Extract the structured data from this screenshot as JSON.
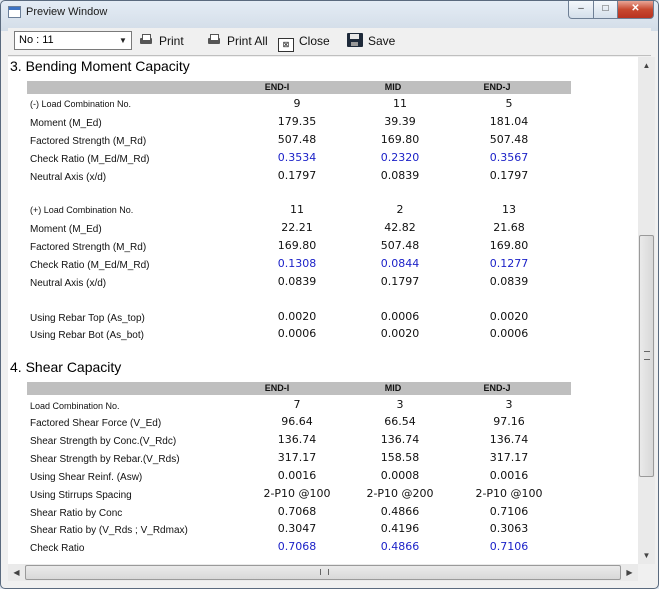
{
  "window": {
    "title": "Preview Window",
    "controls": {
      "minimize": "–",
      "maximize": "□",
      "close": "✕"
    }
  },
  "toolbar": {
    "select_value": "No : 11",
    "buttons": [
      {
        "label": "Print",
        "icon": "printer-icon"
      },
      {
        "label": "Print All",
        "icon": "printer-icon"
      },
      {
        "label": "Close",
        "icon": "close-window-icon"
      },
      {
        "label": "Save",
        "icon": "floppy-disk-icon"
      }
    ]
  },
  "columns": [
    "END-I",
    "MID",
    "END-J"
  ],
  "bending": {
    "title": "3. Bending Moment Capacity",
    "neg_rows": [
      {
        "label": "(-) Load Combination No.",
        "values": [
          "9",
          "11",
          "5"
        ]
      },
      {
        "label": "Moment (M_Ed)",
        "values": [
          "179.35",
          "39.39",
          "181.04"
        ]
      },
      {
        "label": "Factored Strength (M_Rd)",
        "values": [
          "507.48",
          "169.80",
          "507.48"
        ]
      },
      {
        "label": "Check Ratio (M_Ed/M_Rd)",
        "values": [
          "0.3534",
          "0.2320",
          "0.3567"
        ]
      },
      {
        "label": "Neutral Axis (x/d)",
        "values": [
          "0.1797",
          "0.0839",
          "0.1797"
        ]
      }
    ],
    "pos_rows": [
      {
        "label": "(+) Load Combination No.",
        "values": [
          "11",
          "2",
          "13"
        ]
      },
      {
        "label": "Moment (M_Ed)",
        "values": [
          "22.21",
          "42.82",
          "21.68"
        ]
      },
      {
        "label": "Factored Strength (M_Rd)",
        "values": [
          "169.80",
          "507.48",
          "169.80"
        ]
      },
      {
        "label": "Check Ratio (M_Ed/M_Rd)",
        "values": [
          "0.1308",
          "0.0844",
          "0.1277"
        ]
      },
      {
        "label": "Neutral Axis (x/d)",
        "values": [
          "0.0839",
          "0.1797",
          "0.0839"
        ]
      }
    ],
    "rebar_rows": [
      {
        "label": "Using Rebar Top (As_top)",
        "values": [
          "0.0020",
          "0.0006",
          "0.0020"
        ]
      },
      {
        "label": "Using Rebar Bot (As_bot)",
        "values": [
          "0.0006",
          "0.0020",
          "0.0006"
        ]
      }
    ]
  },
  "shear": {
    "title": "4. Shear Capacity",
    "rows": [
      {
        "label": "Load Combination No.",
        "values": [
          "7",
          "3",
          "3"
        ]
      },
      {
        "label": "Factored Shear Force (V_Ed)",
        "values": [
          "96.64",
          "66.54",
          "97.16"
        ]
      },
      {
        "label": "Shear Strength by Conc.(V_Rdc)",
        "values": [
          "136.74",
          "136.74",
          "136.74"
        ]
      },
      {
        "label": "Shear Strength by Rebar.(V_Rds)",
        "values": [
          "317.17",
          "158.58",
          "317.17"
        ]
      },
      {
        "label": "Using Shear Reinf. (Asw)",
        "values": [
          "0.0016",
          "0.0008",
          "0.0016"
        ]
      },
      {
        "label": "Using Stirrups Spacing",
        "values": [
          "2-P10 @100",
          "2-P10 @200",
          "2-P10 @100"
        ]
      },
      {
        "label": "Shear Ratio by Conc",
        "values": [
          "0.7068",
          "0.4866",
          "0.7106"
        ]
      },
      {
        "label": "Shear Ratio by (V_Rds ; V_Rdmax)",
        "values": [
          "0.3047",
          "0.4196",
          "0.3063"
        ]
      },
      {
        "label": "Check Ratio",
        "values": [
          "0.7068",
          "0.4866",
          "0.7106"
        ]
      }
    ]
  },
  "colors": {
    "ratio_text": "#1c22c8",
    "header_bar": "#bfbfbf"
  }
}
